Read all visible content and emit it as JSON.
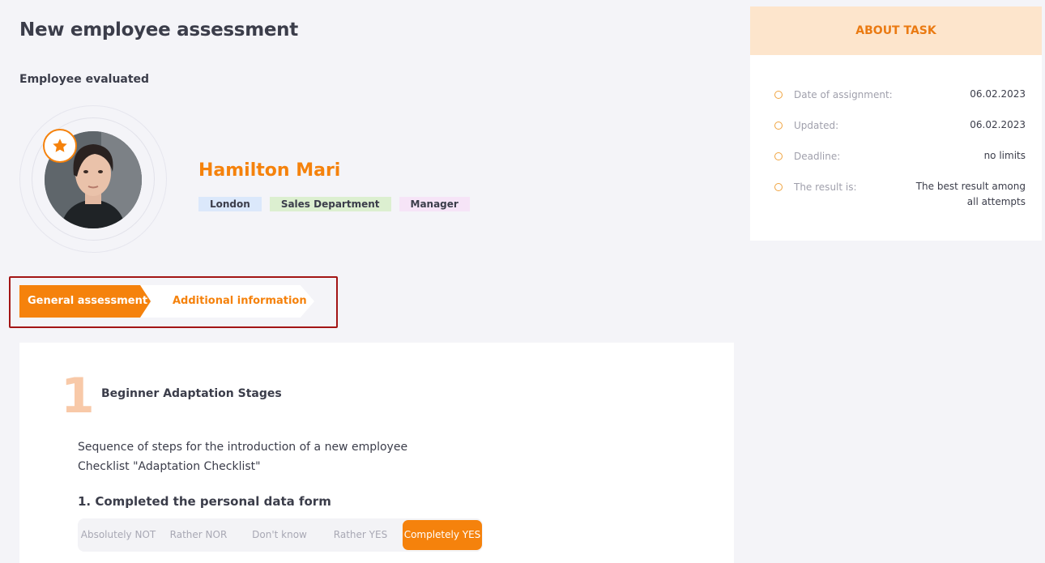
{
  "page": {
    "title": "New employee assessment",
    "section_label": "Employee evaluated"
  },
  "employee": {
    "name": "Hamilton Mari",
    "tags": [
      "London",
      "Sales Department",
      "Manager"
    ]
  },
  "tabs": [
    {
      "label": "General assessment",
      "active": true
    },
    {
      "label": "Additional information",
      "active": false
    }
  ],
  "stage": {
    "number": "1",
    "title": "Beginner Adaptation Stages",
    "description_line1": "Sequence of steps for the introduction of a new employee",
    "description_line2": "Checklist \"Adaptation Checklist\""
  },
  "question": {
    "title": "1. Completed the personal data form",
    "options": [
      "Absolutely NOT",
      "Rather NOR",
      "Don't know",
      "Rather YES",
      "Completely YES"
    ],
    "selected": "Completely YES"
  },
  "about": {
    "header": "ABOUT TASK",
    "rows": [
      {
        "label": "Date of assignment:",
        "value": "06.02.2023"
      },
      {
        "label": "Updated:",
        "value": "06.02.2023"
      },
      {
        "label": "Deadline:",
        "value": "no limits"
      },
      {
        "label": "The result is:",
        "value": "The best result among all attempts"
      }
    ]
  },
  "colors": {
    "accent": "#f5820c",
    "accent_light": "#fde5cc",
    "highlight_frame": "#a31515"
  }
}
